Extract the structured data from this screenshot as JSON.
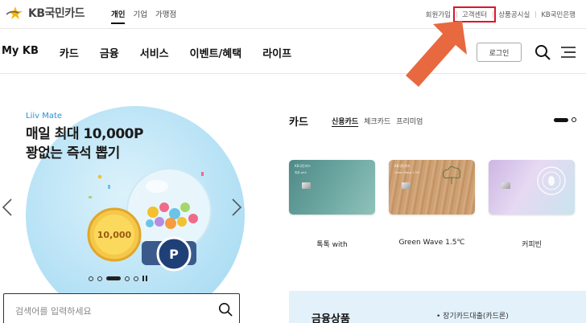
{
  "brand": {
    "logo_text": "KB국민카드"
  },
  "segments": [
    {
      "label": "개인",
      "active": true
    },
    {
      "label": "기업",
      "active": false
    },
    {
      "label": "가맹점",
      "active": false
    }
  ],
  "utility_links": [
    {
      "label": "회원가입",
      "highlighted": false
    },
    {
      "label": "고객센터",
      "highlighted": true
    },
    {
      "label": "상품공시실",
      "highlighted": false
    },
    {
      "label": "KB국민은행",
      "highlighted": false
    }
  ],
  "nav": {
    "items": [
      "My KB",
      "카드",
      "금융",
      "서비스",
      "이벤트/혜택",
      "라이프"
    ],
    "login_label": "로그인",
    "icons": [
      "search-icon",
      "menu-icon"
    ]
  },
  "hero": {
    "tag": "Liiv Mate",
    "title_line1": "매일 최대 10,000P",
    "title_line2": "꽝없는 즉석 뽑기",
    "coin_text": "10,000",
    "badge_letter": "P",
    "indicator": {
      "count": 5,
      "active_index": 2,
      "paused": false
    }
  },
  "search": {
    "placeholder": "검색어를 입력하세요"
  },
  "card_section": {
    "title": "카드",
    "tabs": [
      {
        "label": "신용카드",
        "active": true
      },
      {
        "label": "체크카드",
        "active": false
      },
      {
        "label": "프리미엄",
        "active": false
      }
    ],
    "cards": [
      {
        "name": "톡톡 with",
        "sub": "톡톡 with",
        "brand": "KB국민카드"
      },
      {
        "name": "Green Wave 1.5℃",
        "sub": "Green Wave 1.5℃",
        "brand": "KB국민카드"
      },
      {
        "name": "커피빈",
        "sub": "",
        "brand": ""
      }
    ]
  },
  "finance": {
    "title": "금융상품",
    "items": [
      "장기카드대출(카드론)"
    ]
  },
  "colors": {
    "highlight_red": "#e0142b",
    "arrow_orange": "#e8683f",
    "hero_blue": "#b9e3f6",
    "finance_bg": "#e3f1fb"
  }
}
